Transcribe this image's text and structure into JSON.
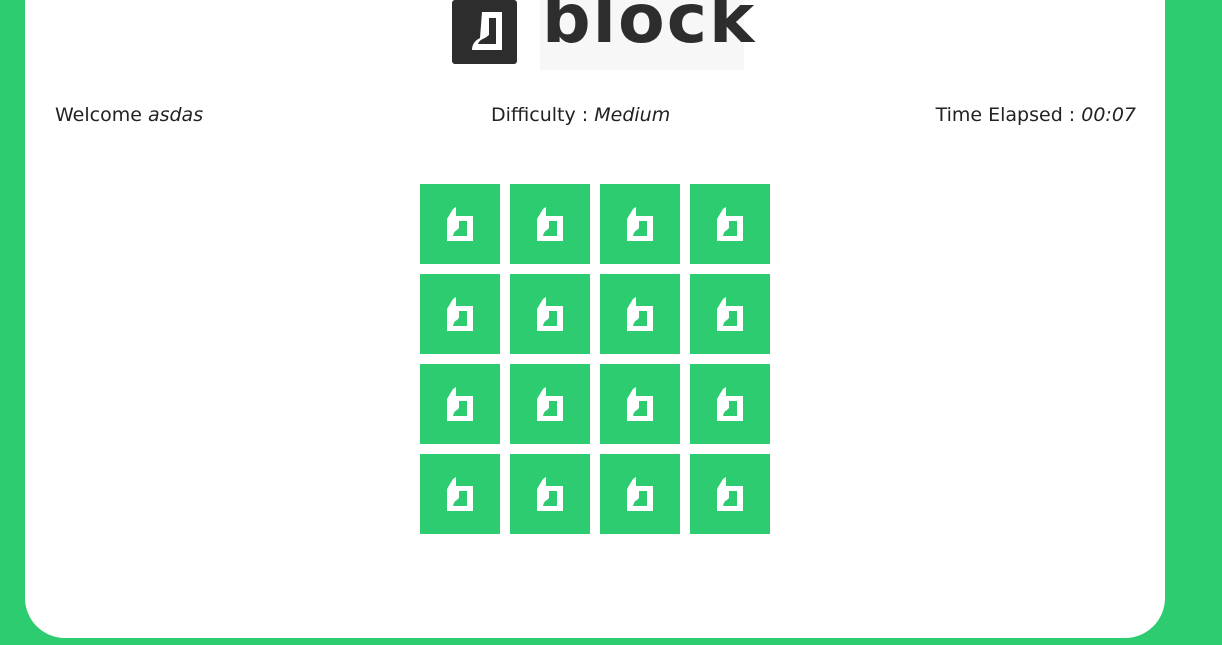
{
  "logo": {
    "word": "block",
    "mark_icon": "block-logo-icon"
  },
  "status": {
    "welcome_label": "Welcome ",
    "username": "asdas",
    "difficulty_label": "Difficulty : ",
    "difficulty_value": "Medium",
    "time_label": "Time Elapsed : ",
    "time_value": "00:07"
  },
  "board": {
    "rows": 4,
    "columns": 4,
    "tile_icon": "block-logo-icon",
    "tile_color": "#2ecc71",
    "tiles_face_down": 16
  },
  "colors": {
    "background": "#2ecc71",
    "card": "#ffffff",
    "logo": "#2d2d2d"
  }
}
